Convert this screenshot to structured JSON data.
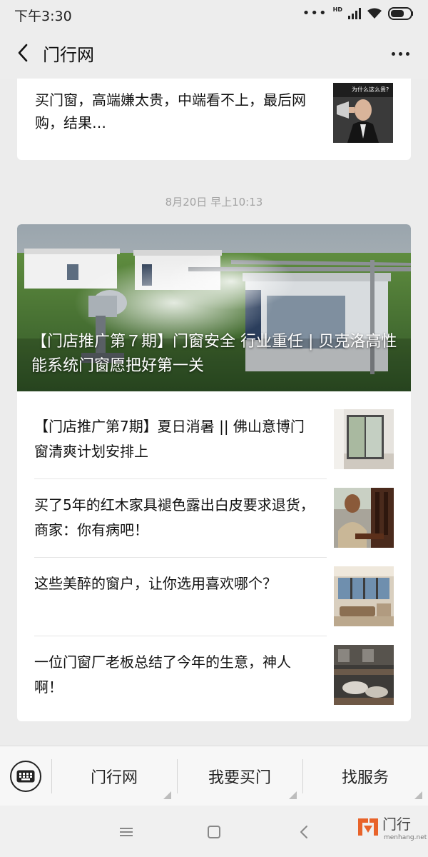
{
  "status_bar": {
    "time": "下午3:30",
    "network_badge": "HD",
    "icons": [
      "more-dots-icon",
      "signal-icon",
      "wifi-icon",
      "battery-icon"
    ]
  },
  "nav": {
    "title": "门行网",
    "back_icon": "chevron-left-icon",
    "more_icon": "more-dots-icon"
  },
  "top_card": {
    "text": "买门窗，高端嫌太贵，中端看不上，最后网购，结果…",
    "thumb_caption": "为什么这么贵?"
  },
  "timestamp": "8月20日 早上10:13",
  "main_card": {
    "hero_title": "【门店推广第７期】门窗安全 行业重任 | 贝克洛高性能系统门窗愿把好第一关",
    "articles": [
      {
        "text": "【门店推广第7期】夏日消暑 || 佛山意博门窗清爽计划安排上"
      },
      {
        "text": "买了5年的红木家具褪色露出白皮要求退货，商家：你有病吧！"
      },
      {
        "text": "这些美醉的窗户，让你选用喜欢哪个？"
      },
      {
        "text": "一位门窗厂老板总结了今年的生意，神人啊！"
      }
    ]
  },
  "menu": {
    "keyboard_icon": "keyboard-icon",
    "items": [
      {
        "label": "门行网"
      },
      {
        "label": "我要买门"
      },
      {
        "label": "找服务"
      }
    ]
  },
  "system_nav": {
    "icons": [
      "menu-icon",
      "home-square-icon",
      "back-icon"
    ]
  },
  "watermark": {
    "main": "门行",
    "sub": "menhang.net"
  },
  "colors": {
    "background": "#ececec",
    "card": "#ffffff",
    "timestamp": "#a3a3a3",
    "brand_orange": "#e8632a"
  }
}
